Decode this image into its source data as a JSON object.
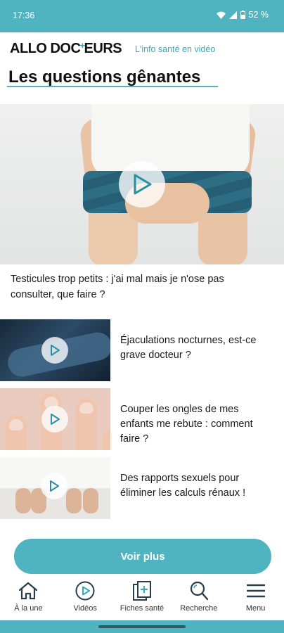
{
  "status_bar": {
    "time": "17:36",
    "battery": "52 %",
    "icons": [
      "wifi-icon",
      "signal-icon",
      "battery-icon"
    ]
  },
  "header": {
    "logo_part1": "ALLO DOC",
    "logo_cross": "+",
    "logo_part2": "EURS",
    "tagline": "L'info santé en vidéo"
  },
  "section": {
    "title": "Les questions gênantes"
  },
  "featured": {
    "caption": "Testicules trop petits : j'ai mal mais je n'ose pas consulter, que faire ?"
  },
  "articles": [
    {
      "title": "Éjaculations nocturnes, est-ce grave docteur ?"
    },
    {
      "title": "Couper les ongles de mes enfants me rebute : comment faire ?"
    },
    {
      "title": "Des rapports sexuels pour éliminer les calculs rénaux !"
    }
  ],
  "cta": {
    "label": "Voir plus"
  },
  "bottom_nav": [
    {
      "label": "À la une",
      "icon": "home-icon"
    },
    {
      "label": "Vidéos",
      "icon": "play-icon"
    },
    {
      "label": "Fiches santé",
      "icon": "health-sheet-icon"
    },
    {
      "label": "Recherche",
      "icon": "search-icon"
    },
    {
      "label": "Menu",
      "icon": "menu-icon"
    }
  ],
  "colors": {
    "brand": "#4fb3c0",
    "accent": "#3aa9b8",
    "text": "#1a1a1a"
  }
}
